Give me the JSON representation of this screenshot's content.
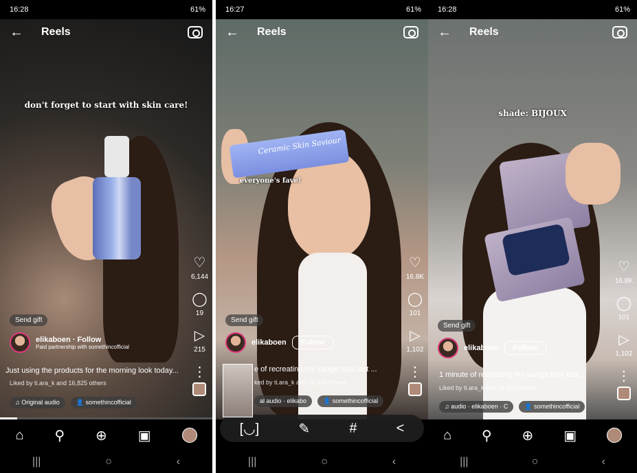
{
  "screens": [
    {
      "status": {
        "time": "16:28",
        "battery": "61%"
      },
      "header": {
        "title": "Reels"
      },
      "overlay_text": "don't forget to start with skin care!",
      "actions": {
        "likes": "6,144",
        "comments": "19",
        "shares": "215"
      },
      "send_gift": "Send gift",
      "user": {
        "name": "elikaboen",
        "follow": "Follow",
        "sub": "Paid partnership with somethincofficial"
      },
      "description": "Just using the products for the morning look today...",
      "liked_by": "Liked by ti.ara_k and 16,825 others",
      "audio": "Original audio",
      "tag": "somethincofficial"
    },
    {
      "status": {
        "time": "16:27",
        "battery": "61%"
      },
      "header": {
        "title": "Reels"
      },
      "overlay_text": "everyone's fave!",
      "product_text": "Ceramic Skin Saviour",
      "actions": {
        "likes": "16.8K",
        "comments": "101",
        "shares": "1,102"
      },
      "send_gift": "Send gift",
      "user": {
        "name": "elikaboen",
        "follow": "Follow"
      },
      "description": "e of recreating my sangjit look last ...",
      "liked_by": "ked by ti.ara_k and 16,825 others",
      "audio": "al audio · elikabo",
      "tag": "somethincofficial"
    },
    {
      "status": {
        "time": "16:28",
        "battery": "61%"
      },
      "header": {
        "title": "Reels"
      },
      "overlay_text": "shade: BIJOUX",
      "actions": {
        "likes": "16.8K",
        "comments": "101",
        "shares": "1,102"
      },
      "send_gift": "Send gift",
      "user": {
        "name": "elikaboen",
        "follow": "Follow"
      },
      "description": "1 minute of recreating my sangjit look last ...",
      "liked_by": "Liked by ti.ara_k and 16,825 others",
      "audio": "audio · elikaboen · C",
      "tag": "somethincofficial"
    }
  ],
  "icons": {
    "back": "←",
    "heart": "♡",
    "comment": "◯",
    "share": "▷",
    "more": "⋮",
    "home": "⌂",
    "search": "⚲",
    "add": "⊕",
    "reels": "▣",
    "menu": "|||",
    "homebtn": "○",
    "backbtn": "‹",
    "music": "♫",
    "person": "👤",
    "gift": "🎁"
  },
  "share_bar": {
    "scan": "[◡]",
    "edit": "✎",
    "hash": "#",
    "share": "<"
  }
}
